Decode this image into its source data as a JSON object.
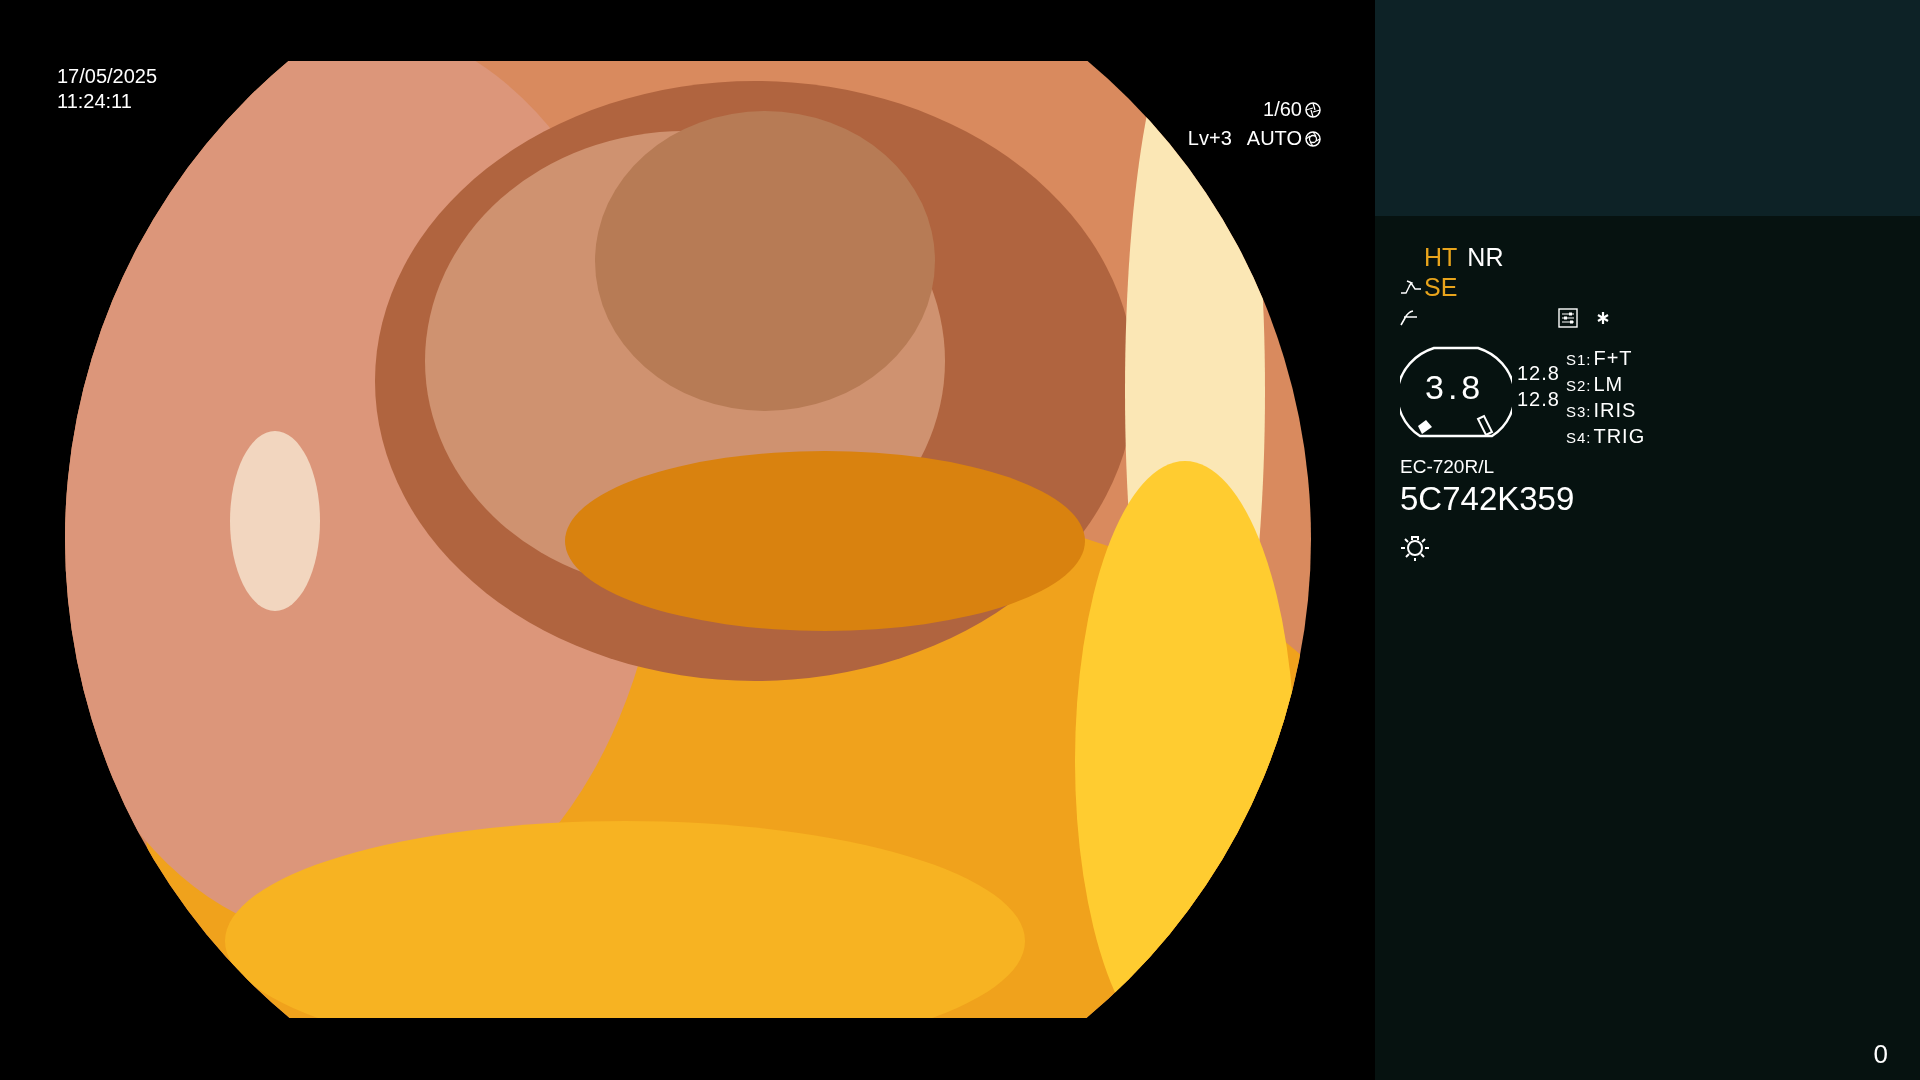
{
  "timestamp": {
    "date": "17/05/2025",
    "time": "11:24:11"
  },
  "exposure": {
    "shutter": "1/60",
    "level": "Lv+3",
    "mode": "AUTO"
  },
  "modes": [
    {
      "label": "HT",
      "on": true
    },
    {
      "label": "NR",
      "on": false
    }
  ],
  "enhancement": {
    "label": "SE",
    "on": true
  },
  "gauge": {
    "value": "3.8",
    "readings": [
      "12.8",
      "12.8"
    ]
  },
  "switches": [
    {
      "key": "S1:",
      "value": "F+T"
    },
    {
      "key": "S2:",
      "value": "LM"
    },
    {
      "key": "S3:",
      "value": "IRIS"
    },
    {
      "key": "S4:",
      "value": "TRIG"
    }
  ],
  "scope": {
    "model": "EC-720R/L",
    "serial": "5C742K359"
  },
  "counter": "0"
}
